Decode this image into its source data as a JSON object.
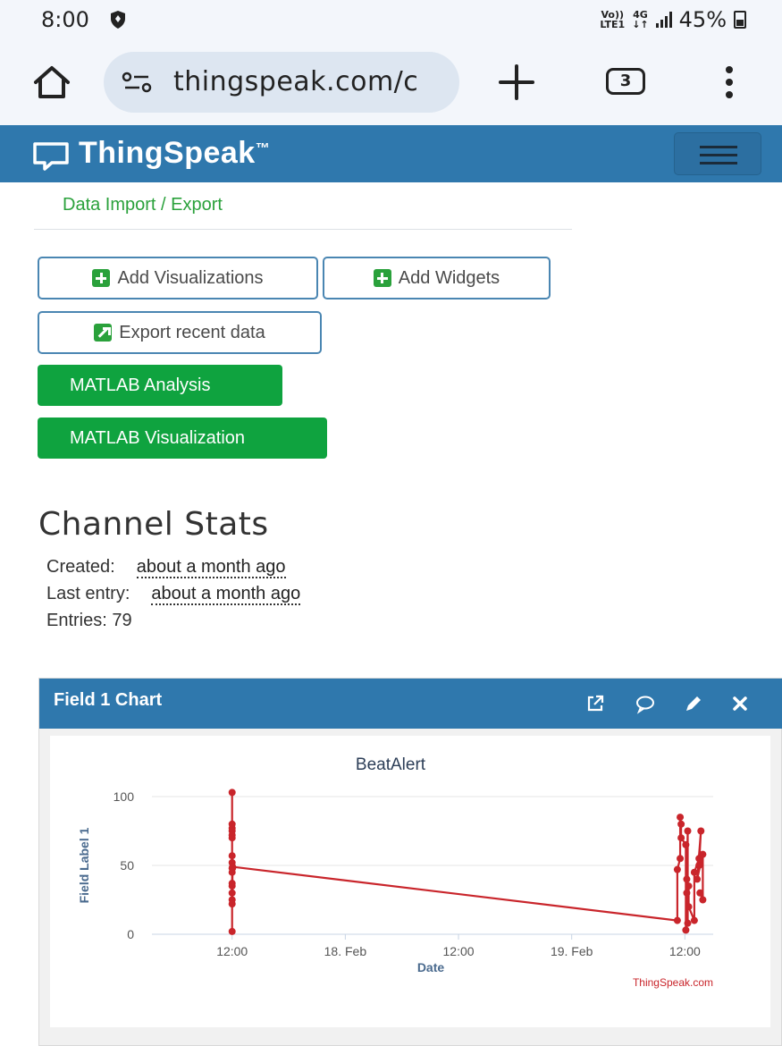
{
  "status_bar": {
    "time": "8:00",
    "network_top": "Vo))",
    "network_bottom": "LTE1",
    "data_top": "4G",
    "data_bottom": "↓↑",
    "battery": "45%"
  },
  "browser": {
    "url": "thingspeak.com/c",
    "tab_count": "3",
    "icons": [
      "home-icon",
      "site-settings-icon",
      "new-tab-icon",
      "tabs-icon",
      "more-vert-icon"
    ]
  },
  "navbar": {
    "brand": "ThingSpeak",
    "trademark": "™"
  },
  "content": {
    "data_import_export": "Data Import / Export",
    "buttons": {
      "add_visualizations": "Add Visualizations",
      "add_widgets": "Add Widgets",
      "export_recent": "Export recent data",
      "matlab_analysis": "MATLAB Analysis",
      "matlab_visualization": "MATLAB Visualization"
    }
  },
  "channel_stats": {
    "title": "Channel Stats",
    "created_label": "Created:",
    "created_value": "about a month ago",
    "last_entry_label": "Last entry:",
    "last_entry_value": "about a month ago",
    "entries": "Entries: 79"
  },
  "field_chart": {
    "panel_title": "Field 1 Chart",
    "credit": "ThingSpeak.com"
  },
  "colors": {
    "nav_blue": "#2f78ad",
    "green": "#0fa33f",
    "line_red": "#c9252b"
  },
  "chart_data": {
    "type": "line",
    "title": "BeatAlert",
    "xlabel": "Date",
    "ylabel": "Field Label 1",
    "ylim": [
      0,
      100
    ],
    "yticks": [
      0,
      50,
      100
    ],
    "xticks": [
      "12:00",
      "18. Feb",
      "12:00",
      "19. Feb",
      "12:00"
    ],
    "xtick_positions_hours": [
      12,
      24,
      36,
      48,
      60
    ],
    "x_unit": "hours since 17 Feb 00:00",
    "series": [
      {
        "name": "Field Label 1",
        "color": "#c9252b",
        "x": [
          12.0,
          12.0,
          12.0,
          12.0,
          12.0,
          12.0,
          12.0,
          12.0,
          12.0,
          12.0,
          12.0,
          12.0,
          12.0,
          12.0,
          12.0,
          12.0,
          12.05,
          12.05,
          59.2,
          59.2,
          59.5,
          59.5,
          59.6,
          59.6,
          60.1,
          60.1,
          60.3,
          60.3,
          60.2,
          60.2,
          60.4,
          60.4,
          61.0,
          61.0,
          61.5,
          61.5,
          61.7,
          61.3,
          61.9,
          61.9,
          61.6
        ],
        "y": [
          2,
          103,
          75,
          77,
          70,
          80,
          72,
          57,
          48,
          52,
          45,
          30,
          35,
          37,
          25,
          22,
          48,
          49,
          10,
          47,
          55,
          85,
          80,
          70,
          65,
          3,
          8,
          75,
          40,
          30,
          35,
          20,
          10,
          45,
          55,
          50,
          75,
          40,
          58,
          25,
          30
        ]
      }
    ]
  }
}
